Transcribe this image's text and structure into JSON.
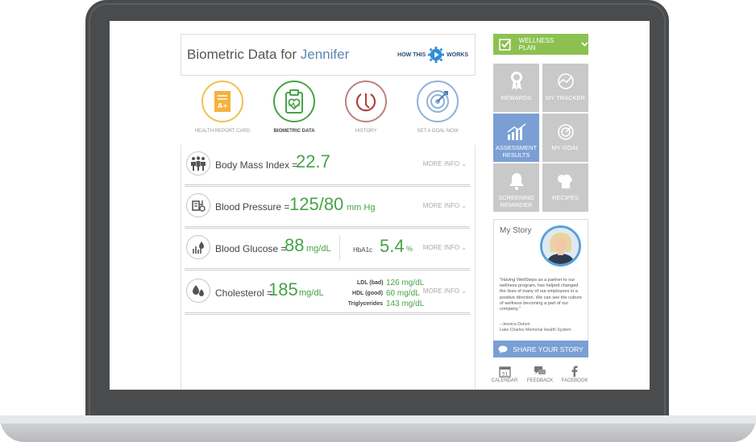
{
  "header": {
    "title_prefix": "Biometric Data for ",
    "user_name": "Jennifer",
    "how_left": "HOW THIS",
    "how_right": "WORKS"
  },
  "tabs": [
    {
      "label": "HEALTH REPORT CARD"
    },
    {
      "label": "BIOMETRIC DATA"
    },
    {
      "label": "HISTORY"
    },
    {
      "label": "SET A GOAL NOW"
    }
  ],
  "metrics": {
    "bmi": {
      "label": "Body Mass Index =",
      "value": "22.7",
      "more": "MORE INFO"
    },
    "bp": {
      "label": "Blood Pressure =",
      "value": "125/80",
      "unit": "mm Hg",
      "more": "MORE INFO"
    },
    "glucose": {
      "label": "Blood Glucose =",
      "value": "88",
      "unit": "mg/dL",
      "hba1c_label": "HbA1c",
      "hba1c_value": "5.4",
      "hba1c_unit": "%",
      "more": "MORE INFO"
    },
    "chol": {
      "label": "Cholesterol =",
      "value": "185",
      "unit": "mg/dL",
      "more": "MORE INFO",
      "ldl_label": "LDL (bad)",
      "ldl_value": "126 mg/dL",
      "hdl_label": "HDL (good)",
      "hdl_value": "60 mg/dL",
      "tri_label": "Triglycerides",
      "tri_value": "143 mg/dL"
    }
  },
  "sidebar": {
    "wellness_plan": "WELLNESS PLAN",
    "tiles": [
      "REWARDS",
      "MY TRACKER",
      "ASSESSMENT RESULTS",
      "MY GOAL",
      "SCREENING REMINDER",
      "RECIPES"
    ],
    "story_title": "My Story",
    "quote": "\"Having WellSteps as a partner to our wellness program, has helped changed the lives of many of our employees in a positive direction. We can see the culture of wellness becoming a part of our company.\"",
    "quote_author": "--Jessica Duhon",
    "quote_org": "Lake Charles Memorial Health System",
    "share": "SHARE YOUR STORY",
    "calendar_day": "31",
    "social": [
      "CALENDAR",
      "FEEDBACK",
      "FACEBOOK"
    ]
  },
  "colors": {
    "green": "#47a347",
    "plan_green": "#8cc151",
    "blue_tile": "#7b9fd4",
    "name_blue": "#5b87b3"
  }
}
